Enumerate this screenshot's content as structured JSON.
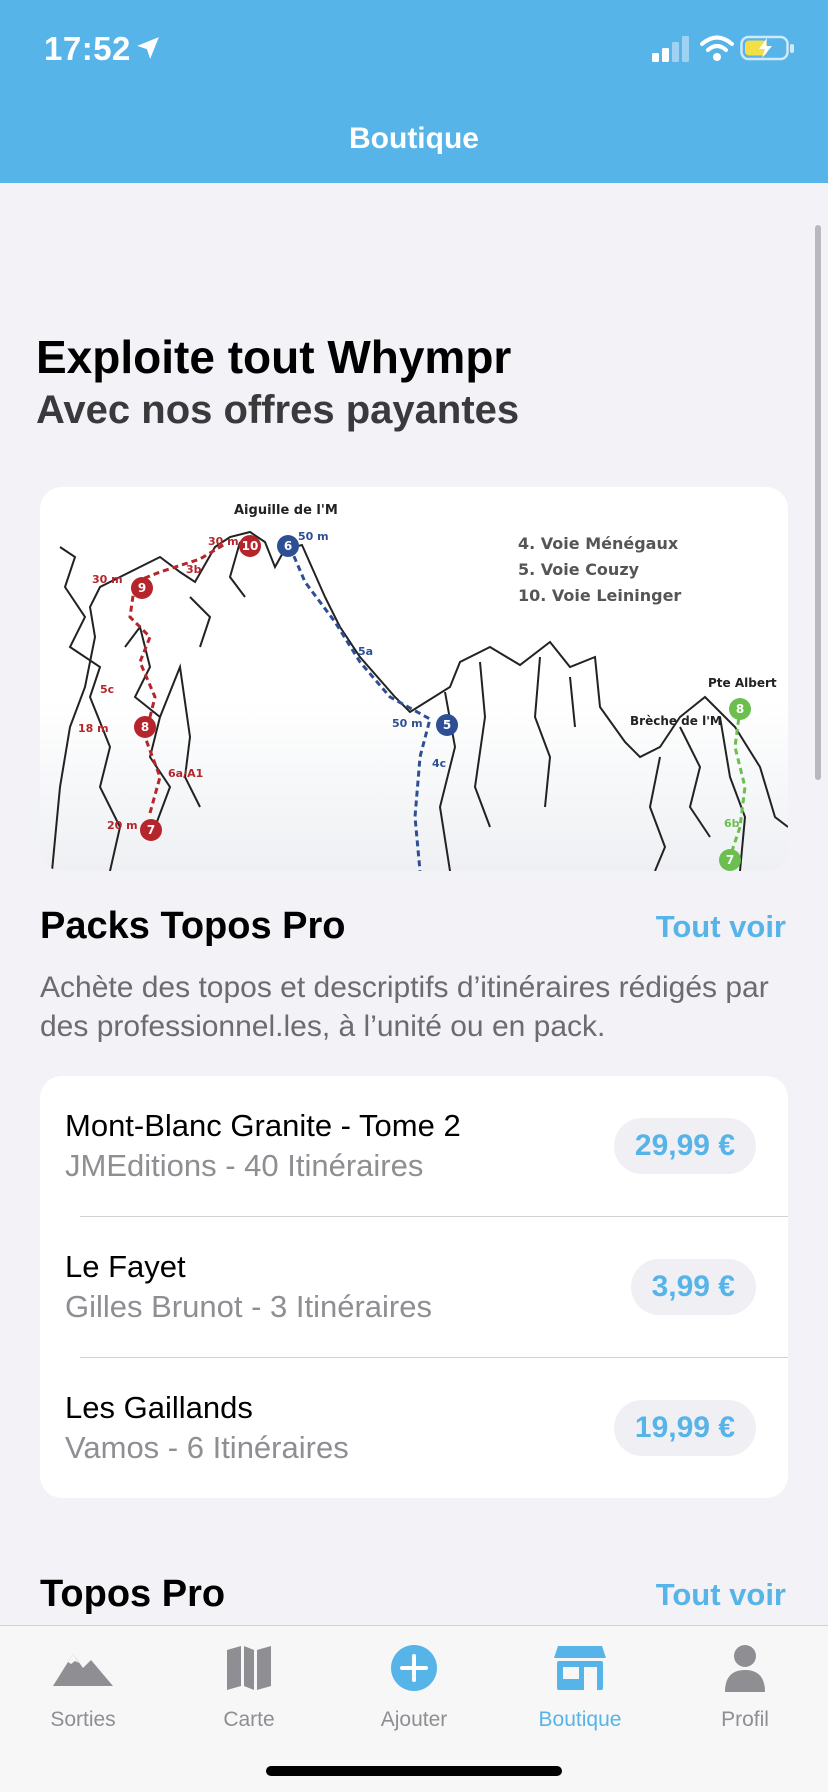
{
  "status": {
    "time": "17:52"
  },
  "header": {
    "title": "Boutique"
  },
  "hero": {
    "title": "Exploite tout Whympr",
    "subtitle": "Avec nos offres payantes"
  },
  "topo": {
    "summit": "Aiguille de l'M",
    "legend": [
      "4. Voie Ménégaux",
      "5. Voie Couzy",
      "10. Voie Leininger"
    ],
    "labels": {
      "pte_albert": "Pte Albert",
      "breche": "Brèche de l'M",
      "l_30m_a": "30 m",
      "l_50m_a": "50 m",
      "l_30m_b": "30 m",
      "l_3b": "3b",
      "l_5a": "5a",
      "l_50m_b": "50 m",
      "l_4c": "4c",
      "l_5c": "5c",
      "l_18m": "18 m",
      "l_6a": "6a/A1",
      "l_20m": "20 m",
      "l_6b": "6b",
      "n10": "10",
      "n6": "6",
      "n9": "9",
      "n8": "8",
      "n7": "7",
      "n5": "5",
      "n8g": "8",
      "n7g": "7"
    }
  },
  "packs": {
    "title": "Packs Topos Pro",
    "see_all": "Tout voir",
    "description": "Achète des topos et descriptifs d’itinéraires rédigés par des professionnel.les, à l’unité ou en pack.",
    "items": [
      {
        "title": "Mont-Blanc Granite - Tome 2",
        "subtitle": "JMEditions - 40 Itinéraires",
        "price": "29,99 €"
      },
      {
        "title": "Le Fayet",
        "subtitle": "Gilles Brunot - 3 Itinéraires",
        "price": "3,99 €"
      },
      {
        "title": "Les Gaillands",
        "subtitle": "Vamos - 6 Itinéraires",
        "price": "19,99 €"
      }
    ]
  },
  "topos_pro": {
    "title": "Topos Pro",
    "see_all": "Tout voir"
  },
  "tabs": [
    {
      "label": "Sorties",
      "icon": "mountain-icon"
    },
    {
      "label": "Carte",
      "icon": "map-icon"
    },
    {
      "label": "Ajouter",
      "icon": "plus-circle-icon"
    },
    {
      "label": "Boutique",
      "icon": "shop-icon"
    },
    {
      "label": "Profil",
      "icon": "person-icon"
    }
  ],
  "colors": {
    "accent": "#56b4e9",
    "red_route": "#b5252b",
    "blue_route": "#2f4f94",
    "green_route": "#6bbf4e"
  }
}
